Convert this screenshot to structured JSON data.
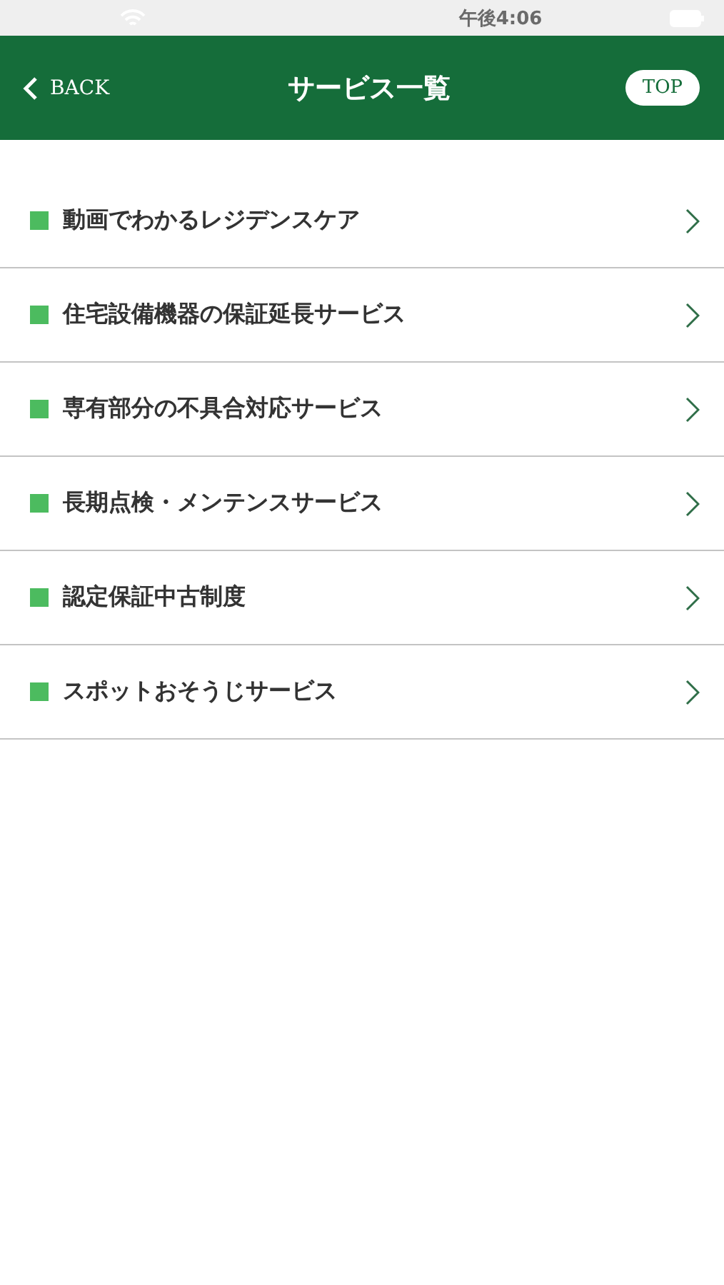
{
  "status_bar": {
    "time": "午後4:06"
  },
  "header": {
    "back": "BACK",
    "title": "サービス一覧",
    "top": "TOP"
  },
  "items": [
    {
      "label": "動画でわかるレジデンスケア"
    },
    {
      "label": "住宅設備機器の保証延長サービス"
    },
    {
      "label": "専有部分の不具合対応サービス"
    },
    {
      "label": "長期点検・メンテンスサービス"
    },
    {
      "label": "認定保証中古制度"
    },
    {
      "label": "スポットおそうじサービス"
    }
  ]
}
